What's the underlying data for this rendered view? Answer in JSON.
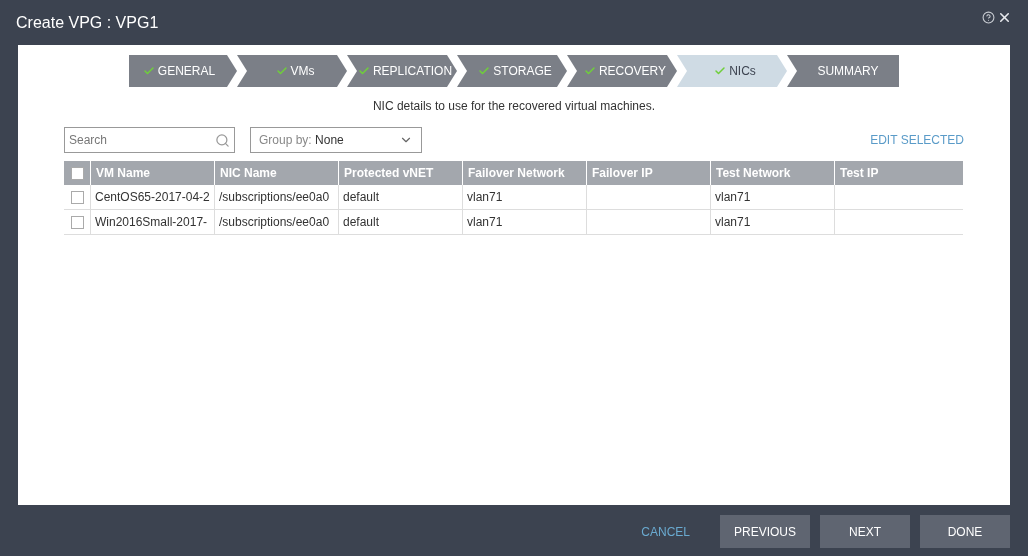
{
  "window": {
    "title": "Create VPG : VPG1"
  },
  "steps": [
    {
      "label": "GENERAL",
      "done": true,
      "selected": false
    },
    {
      "label": "VMs",
      "done": true,
      "selected": false
    },
    {
      "label": "REPLICATION",
      "done": true,
      "selected": false
    },
    {
      "label": "STORAGE",
      "done": true,
      "selected": false
    },
    {
      "label": "RECOVERY",
      "done": true,
      "selected": false
    },
    {
      "label": "NICs",
      "done": true,
      "selected": true
    },
    {
      "label": "SUMMARY",
      "done": false,
      "selected": false
    }
  ],
  "description": "NIC details to use for the recovered virtual machines.",
  "search": {
    "placeholder": "Search"
  },
  "group_by": {
    "label": "Group by:",
    "value": "None"
  },
  "edit_selected": "EDIT SELECTED",
  "table": {
    "all_checked": false,
    "columns": [
      "VM Name",
      "NIC Name",
      "Protected vNET",
      "Failover Network",
      "Failover IP",
      "Test Network",
      "Test IP"
    ],
    "rows": [
      {
        "checked": false,
        "cells": [
          "CentOS65-2017-04-2",
          "/subscriptions/ee0a0",
          "default",
          "vlan71",
          null,
          "vlan71",
          null
        ]
      },
      {
        "checked": false,
        "cells": [
          "Win2016Small-2017-",
          "/subscriptions/ee0a0",
          "default",
          "vlan71",
          null,
          "vlan71",
          null
        ]
      }
    ]
  },
  "footer": {
    "cancel": "CANCEL",
    "buttons": [
      "PREVIOUS",
      "NEXT",
      "DONE"
    ]
  }
}
